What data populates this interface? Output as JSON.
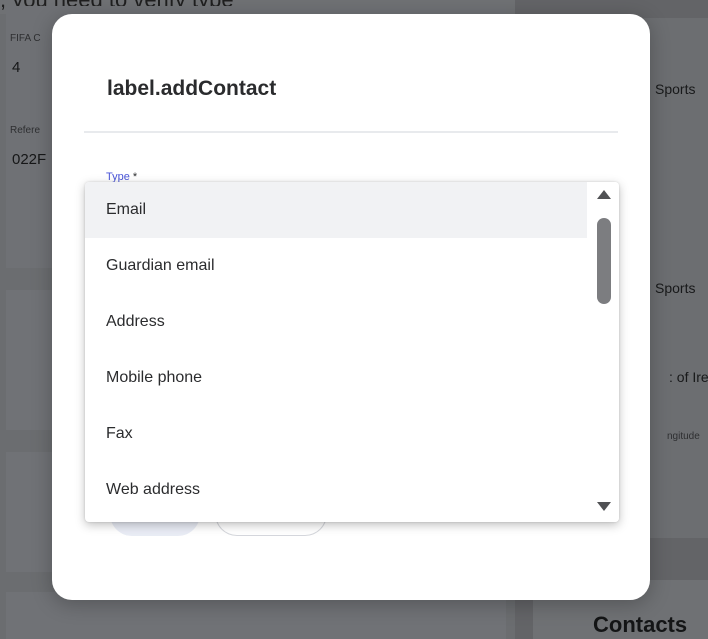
{
  "background": {
    "top_text": ", you need to verify type",
    "left_fields": [
      {
        "label": "FIFA C",
        "value": "4"
      },
      {
        "label": "Refere",
        "value": "022F"
      }
    ],
    "right_texts": [
      "Sports",
      "Sports",
      ": of Irel",
      "ngitude"
    ],
    "contacts_heading": "Contacts"
  },
  "modal": {
    "title": "label.addContact",
    "type_label": "Type",
    "required_marker": "*"
  },
  "dropdown": {
    "options": [
      {
        "label": "Email",
        "selected": true
      },
      {
        "label": "Guardian email",
        "selected": false
      },
      {
        "label": "Address",
        "selected": false
      },
      {
        "label": "Mobile phone",
        "selected": false
      },
      {
        "label": "Fax",
        "selected": false
      },
      {
        "label": "Web address",
        "selected": false
      }
    ]
  },
  "colors": {
    "overlay": "#6b6d70",
    "accent": "#4a55d8",
    "selected_row": "#f1f2f4"
  }
}
